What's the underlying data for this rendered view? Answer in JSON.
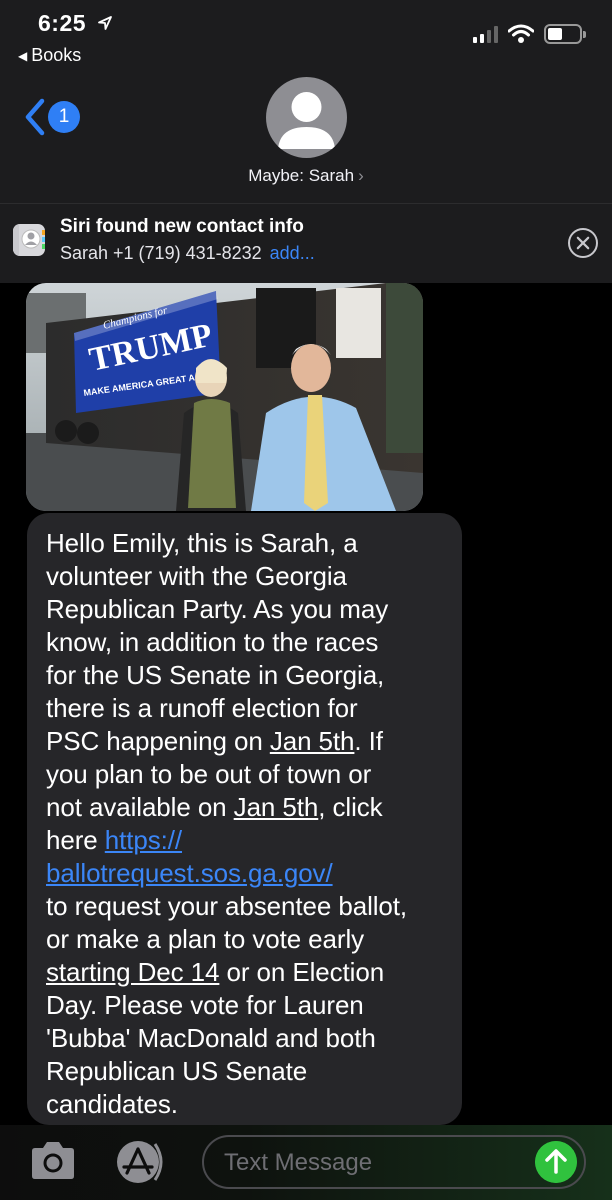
{
  "status_bar": {
    "time": "6:25",
    "back_app_label": "Books"
  },
  "header": {
    "back_badge_count": "1",
    "contact_name": "Maybe: Sarah",
    "contact_chevron": "›"
  },
  "siri_suggestion": {
    "title": "Siri found new contact info",
    "detail": "Sarah +1 (719) 431-8232",
    "add_label": "add..."
  },
  "photo": {
    "sign_script": "Champions for",
    "sign_name": "TRUMP",
    "sign_slogan": "MAKE AMERICA GREAT AGAIN"
  },
  "message": {
    "part1": "Hello Emily, this is Sarah, a\nvolunteer with the Georgia\nRepublican Party. As you may\nknow, in addition to the races\nfor the US Senate in Georgia,\nthere is a runoff election for\nPSC happening on ",
    "date1": "Jan 5th",
    "part2": ". If\nyou plan to be out of town or\nnot available on ",
    "date2": "Jan 5th",
    "part3": ", click\nhere ",
    "link_line1": "https://",
    "link_line2": "ballotrequest.sos.ga.gov/",
    "part4": "\nto request your absentee ballot,\nor make a plan to vote early\n",
    "date3": "starting Dec 14",
    "part5": " or on Election\nDay. Please vote for Lauren\n'Bubba' MacDonald and both\nRepublican US Senate\ncandidates."
  },
  "input_bar": {
    "placeholder": "Text Message"
  },
  "colors": {
    "accent_blue": "#2f7ff5",
    "send_green": "#30c23e",
    "bubble_gray": "#262629"
  }
}
